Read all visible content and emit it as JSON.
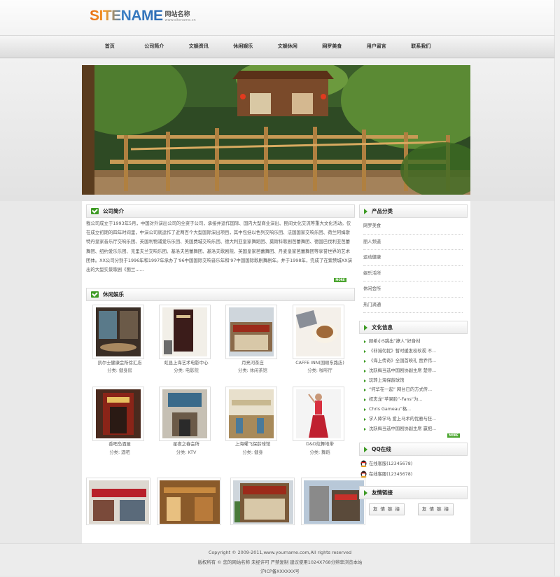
{
  "header": {
    "logo_text": "SITENAME",
    "logo_cn": "网站名称",
    "logo_url": "www.sitename.cn"
  },
  "nav": {
    "items": [
      "首页",
      "公司简介",
      "文娱资讯",
      "休闲娱乐",
      "文娱休闲",
      "网罗美食",
      "用户留言",
      "联系我们"
    ]
  },
  "intro": {
    "title": "公司简介",
    "text": "我公司成立于1993年5月，中国对外演出公司的全资子公司，承接并运作国际、国内大型商业演出、民间文化交流等重大文化活动。仅在成立初期的四年时间里，中演公司就运作了近两百个大型国际演出项目，其中包括以色列交响乐团、法国国家交响乐团、荷兰阿姆斯特丹皇家音乐厅交响乐团、英国利物浦爱乐乐团、美国费城交响乐团、德大利亚皇家舞蹈团、莫斯科歌剧芭蕾舞团、德国巴伐利亚芭蕾舞团、纽约爱乐乐团、克里夫兰交响乐团、基洛夫芭蕾舞团、基洛夫歌剧院、英国皇家芭蕾舞团、丹麦皇家芭蕾舞团等享誉世界的艺术团体。XX公司分别于1996年和1997年承办了'96中国国际交响音乐年和'97中国国际歌剧舞剧年。并于1998年，完成了在紫禁城XX演出的大型实景歌剧《图兰……",
    "more": "MORE"
  },
  "leisure": {
    "title": "休闲娱乐",
    "items": [
      {
        "name": "凯尔士健康会所徐汇店",
        "category": "分类: 健身房"
      },
      {
        "name": "虹县上海艺术电影中心",
        "category": "分类: 电影院"
      },
      {
        "name": "月亮河茶庄",
        "category": "分类: 休闲茶馆"
      },
      {
        "name": "CAFFE INN(国顺东路店)",
        "category": "分类: 咖啡厅"
      },
      {
        "name": "香吧岛酒屋",
        "category": "分类: 酒吧"
      },
      {
        "name": "星夜之春会所",
        "category": "分类: KTV"
      },
      {
        "name": "上海曜飞保龄球馆",
        "category": "分类: 健身"
      },
      {
        "name": "D&D炫舞地带",
        "category": "分类: 舞蹈"
      }
    ]
  },
  "sidebar": {
    "products": {
      "title": "产品分类",
      "items": [
        "网罗美食",
        "丽人频道",
        "运动健康",
        "娱乐活所",
        "休闲会所",
        "热门滴通"
      ]
    },
    "culture": {
      "title": "文化信息",
      "items": [
        "顾希小S跳出“撩人”好身材",
        "《非诚勿扰》暂时缓发校软视 不...",
        "《海上传奇》全国首映礼 贾乔伟...",
        "沈跃梅当选中国剧协副主席 楚帝...",
        "玩转上海保龄球馆",
        "“何华在一起” 网台已的方式传...",
        "权志龙“苹果脸”-Fans“为...",
        "Chris Gameau“格...",
        "学人降学马 爱上马术的优雅与狂...",
        "沈跃梅当选中国剧协副主席 赢把..."
      ],
      "more": "MORE"
    },
    "qq": {
      "title": "QQ在线",
      "items": [
        "在线客服(12345678)",
        "在线客服(12345678)"
      ]
    },
    "links": {
      "title": "友情链接",
      "items": [
        "友 情 链 接",
        "友 情 链 接"
      ]
    }
  },
  "footer": {
    "lines": [
      "Copyright © 2009-2011,www.yourname.com,All rights reserved",
      "版权所有 © 您的网站名称  未经许可 严禁复制  建议使用1024X768分辨率浏览本站",
      "沪ICP备XXXXXX号"
    ]
  }
}
